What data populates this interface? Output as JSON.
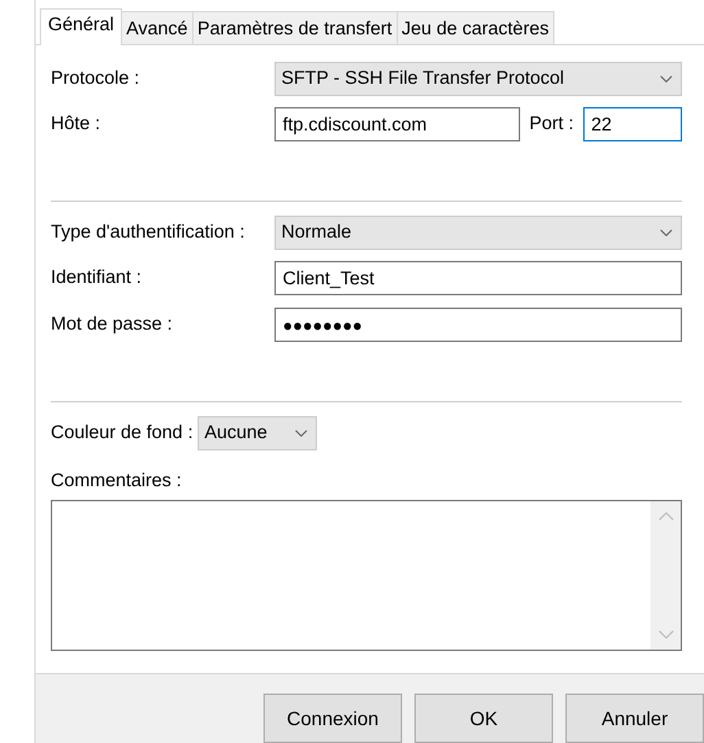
{
  "tabs": [
    {
      "label": "Général",
      "selected": true
    },
    {
      "label": "Avancé",
      "selected": false
    },
    {
      "label": "Paramètres de transfert",
      "selected": false
    },
    {
      "label": "Jeu de caractères",
      "selected": false
    }
  ],
  "protocol": {
    "label": "Protocole :",
    "value": "SFTP - SSH File Transfer Protocol"
  },
  "host": {
    "label": "Hôte :",
    "value": "ftp.cdiscount.com",
    "port_label": "Port :",
    "port": "22",
    "port_focused": true
  },
  "auth_type": {
    "label": "Type d'authentification :",
    "value": "Normale"
  },
  "user": {
    "label": "Identifiant :",
    "value": "Client_Test"
  },
  "password": {
    "label": "Mot de passe :",
    "value": "●●●●●●●●"
  },
  "background_color": {
    "label": "Couleur de fond :",
    "value": "Aucune"
  },
  "comments": {
    "label": "Commentaires :"
  },
  "buttons": [
    "Connexion",
    "OK",
    "Annuler"
  ]
}
